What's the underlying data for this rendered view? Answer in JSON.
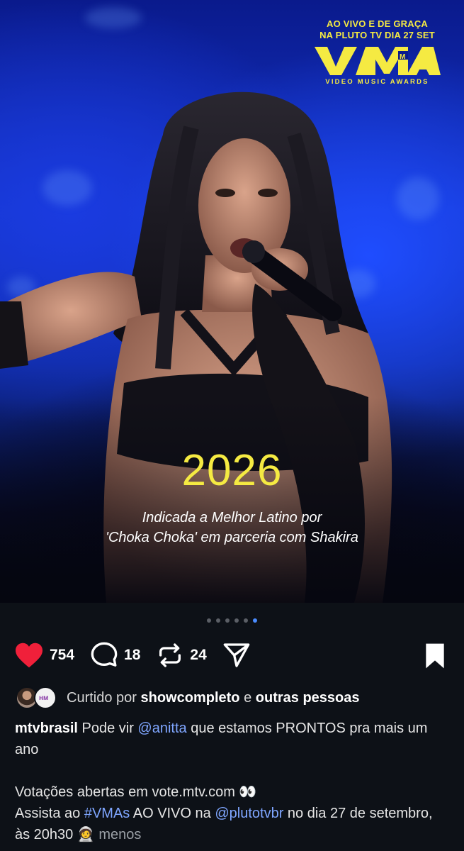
{
  "banner": {
    "line1": "AO VIVO E DE GRAÇA",
    "line2_prefix": "NA ",
    "line2_brand": "PLUTO TV",
    "line2_suffix": " DIA 27 SET",
    "logo_text": "VMA",
    "logo_sub": "VIDEO MUSIC AWARDS",
    "accent_color": "#f5ea42"
  },
  "slide": {
    "year": "2026",
    "caption_line1": "Indicada a Melhor Latino por",
    "caption_line2": "'Choka Choka' em parceria com Shakira"
  },
  "carousel": {
    "count": 6,
    "active_index": 5,
    "active_color": "#4a8cff"
  },
  "actions": {
    "likes": "754",
    "comments": "18",
    "reposts": "24",
    "like_icon": "heart-filled-icon",
    "comment_icon": "comment-bubble-icon",
    "repost_icon": "repost-arrows-icon",
    "share_icon": "paper-plane-icon",
    "save_icon": "bookmark-icon"
  },
  "liked_by": {
    "prefix": "Curtido por ",
    "user": "showcompleto",
    "middle": " e ",
    "others": "outras pessoas"
  },
  "post": {
    "username": "mtvbrasil",
    "text1": " Pode vir ",
    "mention1": "@anitta",
    "text2": " que estamos PRONTOS pra mais um ano",
    "text3": "Votações abertas em vote.mtv.com 👀",
    "text4_prefix": "Assista ao ",
    "hashtag": "#VMAs",
    "text4_mid": " AO VIVO na ",
    "mention2": "@plutotvbr",
    "text4_suffix": " no dia 27 de setembro, às 20h30 🧑‍🚀 ",
    "less": "menos"
  }
}
